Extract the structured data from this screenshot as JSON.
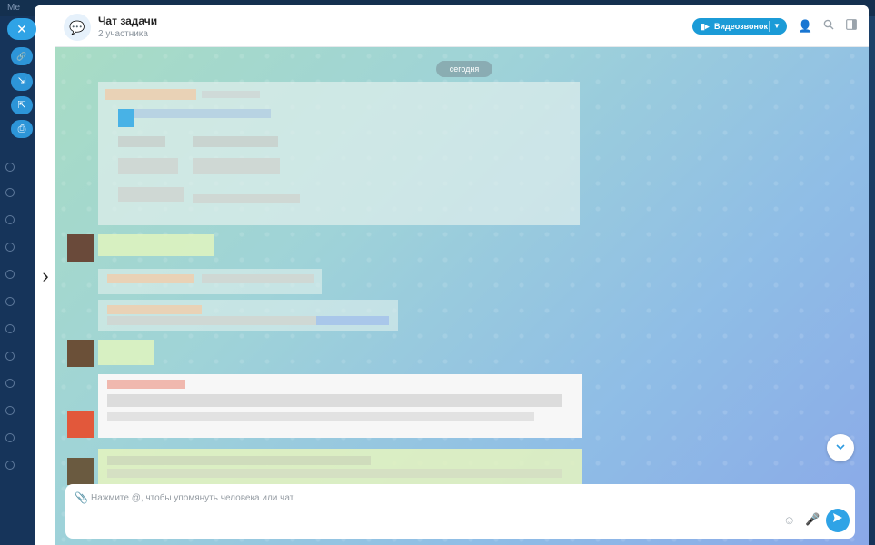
{
  "background_app": {
    "menu_label": "Ме"
  },
  "side_actions": {
    "close_glyph": "✕",
    "link_glyph": "🔗",
    "download_glyph": "⇲",
    "open_glyph": "⇱",
    "print_glyph": "⎙"
  },
  "header": {
    "title": "Чат задачи",
    "subtitle": "2 участника",
    "video_call_label": "Видеозвонок"
  },
  "chat": {
    "date_separator": "сегодня"
  },
  "composer": {
    "placeholder": "Нажмите @, чтобы упомянуть человека или чат"
  },
  "colors": {
    "accent": "#2fa3e6",
    "video_button": "#1b9bd7"
  }
}
